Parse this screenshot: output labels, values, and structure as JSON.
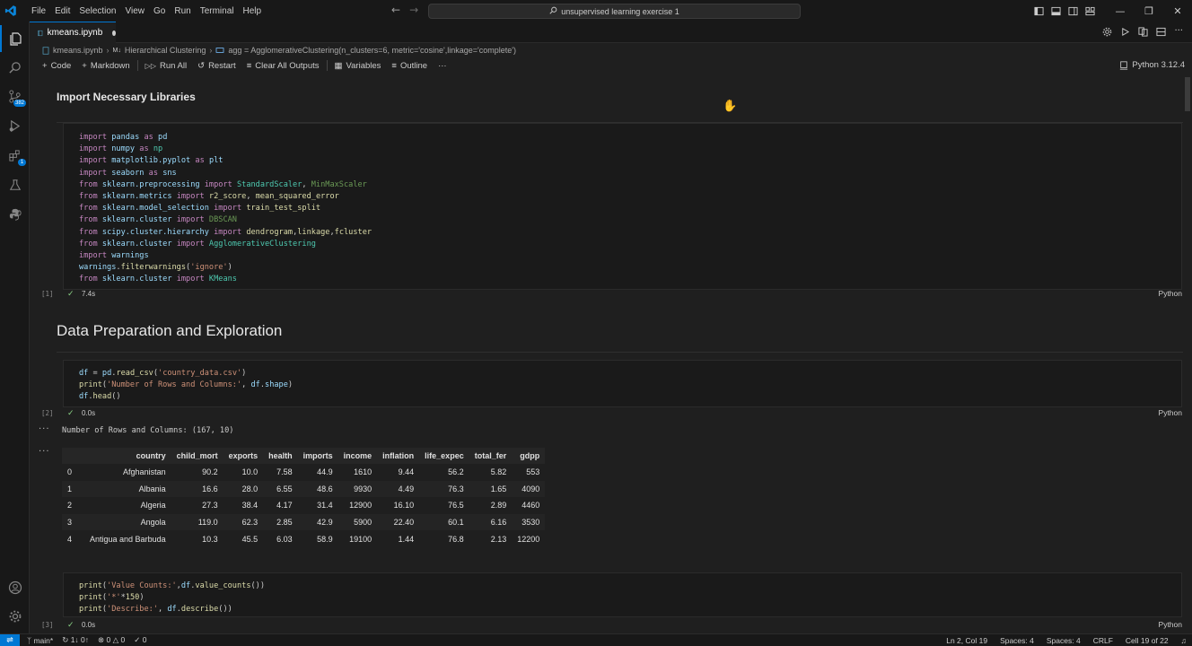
{
  "titlebar": {
    "menu": [
      "File",
      "Edit",
      "Selection",
      "View",
      "Go",
      "Run",
      "Terminal",
      "Help"
    ],
    "search": "unsupervised learning exercise 1"
  },
  "tab": {
    "label": "kmeans.ipynb"
  },
  "breadcrumb": {
    "file": "kmeans.ipynb",
    "section_prefix": "M↓",
    "section": "Hierarchical Clustering",
    "symbol": "agg = AgglomerativeClustering(n_clusters=6, metric='cosine',linkage='complete')"
  },
  "toolbar": {
    "code": "Code",
    "markdown": "Markdown",
    "run_all": "Run All",
    "restart": "Restart",
    "clear_outputs": "Clear All Outputs",
    "variables": "Variables",
    "outline": "Outline",
    "more": "···",
    "kernel": "Python 3.12.4"
  },
  "activity": {
    "scm_badge": "382",
    "ext_badge": "1"
  },
  "headings": {
    "h1": "Import Necessary Libraries",
    "h2": "Data Preparation and Exploration"
  },
  "cell1": {
    "lines": [
      "import pandas as pd",
      "import numpy as np",
      "import matplotlib.pyplot as plt",
      "import seaborn as sns",
      "from sklearn.preprocessing import StandardScaler, MinMaxScaler",
      "from sklearn.metrics import r2_score, mean_squared_error",
      "from sklearn.model_selection import train_test_split",
      "from sklearn.cluster import DBSCAN",
      "from scipy.cluster.hierarchy import dendrogram,linkage,fcluster",
      "from sklearn.cluster import AgglomerativeClustering",
      "import warnings",
      "warnings.filterwarnings('ignore')",
      "from sklearn.cluster import KMeans"
    ],
    "exec": "[1]",
    "time": "7.4s",
    "lang": "Python"
  },
  "cell2": {
    "lines": [
      "df = pd.read_csv('country_data.csv')",
      "print('Number of Rows and Columns:', df.shape)",
      "df.head()"
    ],
    "exec": "[2]",
    "time": "0.0s",
    "lang": "Python",
    "output_text": "Number of Rows and Columns: (167, 10)"
  },
  "table": {
    "columns": [
      "",
      "country",
      "child_mort",
      "exports",
      "health",
      "imports",
      "income",
      "inflation",
      "life_expec",
      "total_fer",
      "gdpp"
    ],
    "rows": [
      [
        "0",
        "Afghanistan",
        "90.2",
        "10.0",
        "7.58",
        "44.9",
        "1610",
        "9.44",
        "56.2",
        "5.82",
        "553"
      ],
      [
        "1",
        "Albania",
        "16.6",
        "28.0",
        "6.55",
        "48.6",
        "9930",
        "4.49",
        "76.3",
        "1.65",
        "4090"
      ],
      [
        "2",
        "Algeria",
        "27.3",
        "38.4",
        "4.17",
        "31.4",
        "12900",
        "16.10",
        "76.5",
        "2.89",
        "4460"
      ],
      [
        "3",
        "Angola",
        "119.0",
        "62.3",
        "2.85",
        "42.9",
        "5900",
        "22.40",
        "60.1",
        "6.16",
        "3530"
      ],
      [
        "4",
        "Antigua and Barbuda",
        "10.3",
        "45.5",
        "6.03",
        "58.9",
        "19100",
        "1.44",
        "76.8",
        "2.13",
        "12200"
      ]
    ]
  },
  "cell3": {
    "lines": [
      "print('Value Counts:',df.value_counts())",
      "print('*'*150)",
      "print('Describe:', df.describe())"
    ],
    "exec": "[3]",
    "time": "0.0s",
    "lang": "Python"
  },
  "statusbar": {
    "branch": "main*",
    "sync": "1↓ 0↑",
    "errors": "0",
    "warnings": "0",
    "ports": "0",
    "position": "Ln 2, Col 19",
    "spaces1": "Spaces: 4",
    "spaces2": "Spaces: 4",
    "eol": "CRLF",
    "cell": "Cell 19 of 22"
  },
  "colors": {
    "accent": "#0078d4",
    "background": "#1f1f1f",
    "check": "#89d185"
  }
}
